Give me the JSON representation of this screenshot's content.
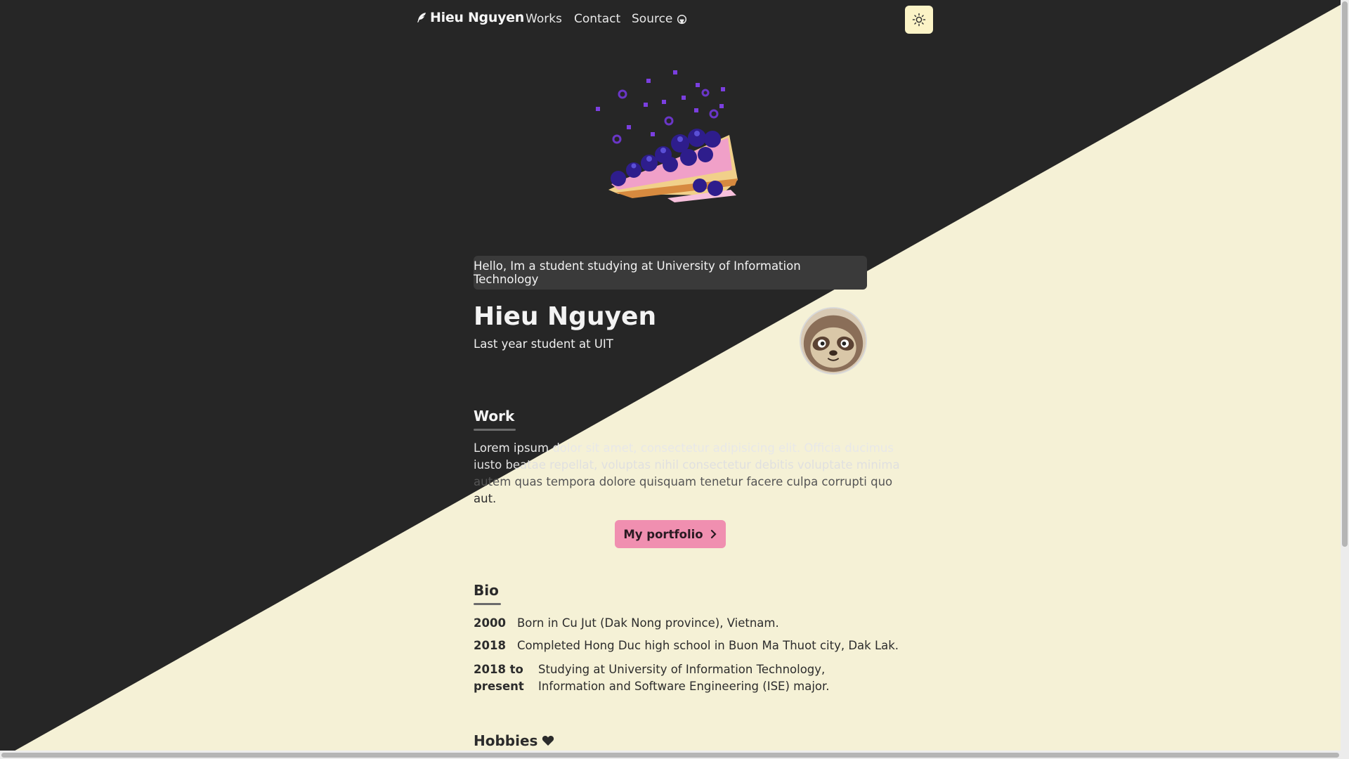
{
  "nav": {
    "brand": "Hieu Nguyen",
    "links": [
      "Works",
      "Contact",
      "Source"
    ],
    "theme_toggle_icon": "sun-icon"
  },
  "greeting": "Hello, Im a student studying at University of Information Technology",
  "profile": {
    "name": "Hieu Nguyen",
    "subtitle": "Last year student at UIT",
    "avatar_icon": "sloth-avatar"
  },
  "work": {
    "title": "Work",
    "lines": [
      "Lorem ipsum dolor sit amet, consectetur adipisicing elit. Officia ducimus",
      "iusto beatae repellat, voluptas nihil consectetur debitis voluptate minima",
      "autem quas tempora dolore quisquam tenetur facere culpa corrupti quo",
      "aut."
    ],
    "button_label": "My portfolio"
  },
  "bio": {
    "title": "Bio",
    "entries": [
      {
        "year": "2000",
        "text": "Born in Cu Jut (Dak Nong province), Vietnam."
      },
      {
        "year": "2018",
        "text": "Completed Hong Duc high school in Buon Ma Thuot city, Dak Lak."
      },
      {
        "year": "2018 to present",
        "text": "Studying at University of Information Technology, Information and Software Engineering (ISE) major."
      }
    ]
  },
  "hobbies": {
    "title": "Hobbies",
    "icon": "heart-icon"
  },
  "colors": {
    "dark_bg": "#262626",
    "light_bg": "#f5f1d6",
    "accent_pink": "#f08fb0",
    "theme_button": "#fbf3c6"
  }
}
